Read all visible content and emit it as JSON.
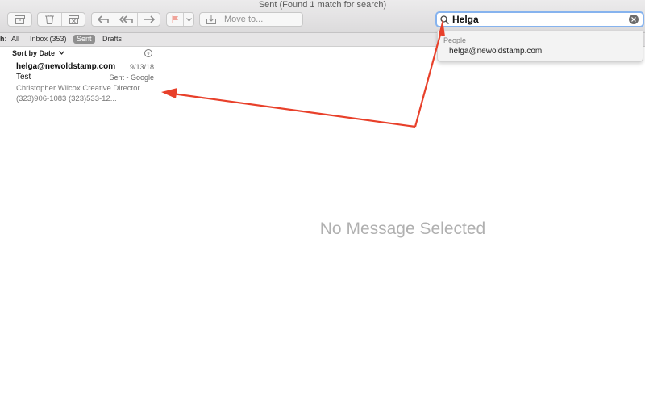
{
  "window": {
    "title": "Sent (Found 1 match for search)"
  },
  "toolbar": {
    "move_to_label": "Move to..."
  },
  "search": {
    "value": "Helga"
  },
  "suggestions": {
    "header": "People",
    "items": [
      "helga@newoldstamp.com"
    ]
  },
  "scope_bar": {
    "prefix": "h:",
    "items": [
      "All",
      "Inbox (353)",
      "Sent",
      "Drafts"
    ],
    "selected": "Sent"
  },
  "message_list": {
    "sort_label": "Sort by Date",
    "messages": [
      {
        "sender": "helga@newoldstamp.com",
        "date": "9/13/18",
        "subject": "Test",
        "mailbox": "Sent - Google",
        "preview": "Christopher Wilcox Creative Director (323)906-1083 (323)533-12..."
      }
    ]
  },
  "reading_pane": {
    "empty_text": "No Message Selected"
  },
  "colors": {
    "annotation": "#e8402a",
    "focus_ring": "#86b3ee",
    "selected_scope": "#8f8f8f"
  }
}
